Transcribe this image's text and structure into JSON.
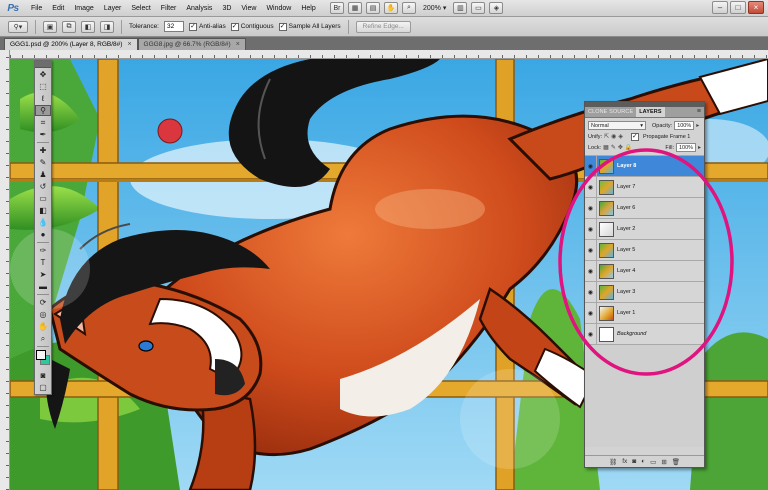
{
  "app": {
    "logo": "Ps"
  },
  "menu": [
    "File",
    "Edit",
    "Image",
    "Layer",
    "Select",
    "Filter",
    "Analysis",
    "3D",
    "View",
    "Window",
    "Help"
  ],
  "menu_right": {
    "zoom": "200%"
  },
  "options": {
    "tolerance_label": "Tolerance:",
    "tolerance_value": "32",
    "antialias_label": "Anti-alias",
    "contiguous_label": "Contiguous",
    "sample_all_label": "Sample All Layers",
    "refine_edge_label": "Refine Edge..."
  },
  "doc_tabs": [
    {
      "label": "GGG1.psd @ 200% (Layer 8, RGB/8#)"
    },
    {
      "label": "GGG8.jpg @ 66.7% (RGB/8#)"
    }
  ],
  "colors": {
    "foreground": "#f5f5f5",
    "background": "#2dc7a0",
    "accent": "#3f88d9",
    "annotation": "#e0137f"
  },
  "panel": {
    "tabs": [
      "CLONE SOURCE",
      "LAYERS"
    ],
    "blend_mode": "Normal",
    "opacity_label": "Opacity:",
    "opacity_value": "100%",
    "unify_label": "Unify:",
    "propagate_label": "Propagate Frame 1",
    "lock_label": "Lock:",
    "fill_label": "Fill:",
    "fill_value": "100%"
  },
  "layers": [
    {
      "name": "Layer 8",
      "selected": true
    },
    {
      "name": "Layer 7",
      "selected": false
    },
    {
      "name": "Layer 6",
      "selected": false
    },
    {
      "name": "Layer 2",
      "selected": false
    },
    {
      "name": "Layer 5",
      "selected": false
    },
    {
      "name": "Layer 4",
      "selected": false
    },
    {
      "name": "Layer 3",
      "selected": false
    },
    {
      "name": "Layer 1",
      "selected": false
    },
    {
      "name": "Background",
      "selected": false
    }
  ]
}
